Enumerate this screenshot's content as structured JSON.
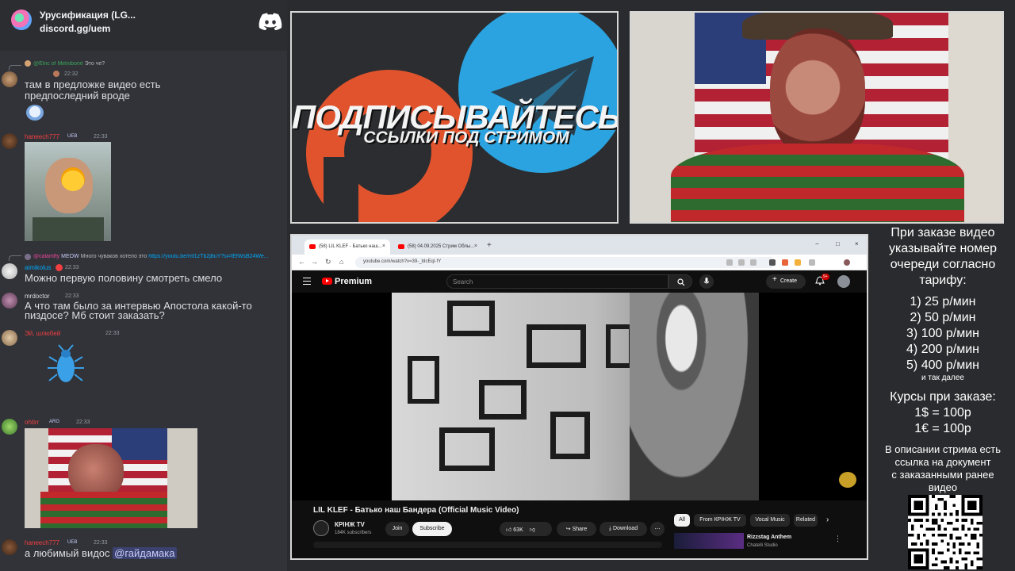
{
  "discord": {
    "server_name": "Урусификация (LG...",
    "server_invite": "discord.gg/uem",
    "messages": [
      {
        "reply_user": "@Elric of Melniboné",
        "reply_text": "Это че?",
        "username": "",
        "timestamp": "22:32",
        "text_lines": [
          "там в предложке видео есть",
          "предпоследний вроде"
        ]
      },
      {
        "username": "haneech777",
        "tag": "UEB",
        "timestamp": "22:33",
        "text_lines": []
      },
      {
        "reply_user": "@calamfty",
        "reply_tag": "MEOW",
        "reply_text": "Много чуваков хотело это",
        "reply_link": "https://youtu.be/mf1zTb2j8uY?si=fEfWsB24We...",
        "username": "aimikolus",
        "timestamp": "22:33",
        "text_lines": [
          "Можно первую половину смотреть смело"
        ]
      },
      {
        "username": "mrdoctor",
        "timestamp": "22:33",
        "text_lines": [
          "А что там было за интервью Апостола какой-то",
          "пиздосе? Мб стоит заказать?"
        ]
      },
      {
        "username": "Эй, шлюбей",
        "timestamp": "22:33",
        "text_lines": []
      },
      {
        "username": "ohtirr",
        "tag": "ARG",
        "timestamp": "22:33",
        "text_lines": []
      },
      {
        "username": "haneech777",
        "tag": "UEB",
        "timestamp": "22:33",
        "text_prefix": "а любимый видос",
        "mention": "@гайдамака"
      }
    ]
  },
  "promo": {
    "title": "ПОДПИСЫВАЙТЕСЬ",
    "subtitle": "ССЫЛКИ ПОД СТРИМОМ"
  },
  "browser": {
    "tabs": [
      {
        "label": "(58) LIL KLEF - Батько наш..."
      },
      {
        "label": "(58) 04.09.2025 Стрим Облы..."
      }
    ],
    "url": "youtube.com/watch?v=39-_bIcEqI-fY",
    "youtube": {
      "brand": "Premium",
      "search_placeholder": "Search",
      "create_label": "Create",
      "notifications_badge": "9+",
      "video_title": "LIL KLEF - Батько наш Бандера (Official Music Video)",
      "channel_name": "КРІНЖ TV",
      "channel_subs": "184K subscribers",
      "join_label": "Join",
      "subscribe_label": "Subscribe",
      "likes": "63K",
      "share_label": "Share",
      "download_label": "Download",
      "chips": [
        "All",
        "From КРІНЖ TV",
        "Vocal Music",
        "Related"
      ],
      "rec_title": "Rizzstag Anthem",
      "rec_channel": "Chatelli Studio"
    }
  },
  "info_panel": {
    "intro": [
      "При заказе видео",
      "указывайте номер",
      "очереди согласно",
      "тарифу:"
    ],
    "tariffs": [
      "1) 25 р/мин",
      "2) 50 р/мин",
      "3) 100 р/мин",
      "4) 200 р/мин",
      "5) 400 р/мин"
    ],
    "etc": "и так далее",
    "rates_title": "Курсы при заказе:",
    "rates": [
      "1$ = 100р",
      "1€ = 100р"
    ],
    "outro": [
      "В описании стрима есть",
      "ссылка на документ",
      "с заказанными ранее",
      "видео"
    ]
  },
  "colors": {
    "discord_bg": "#313338",
    "username_red": "#f23f42",
    "username_blue": "#00a8fc",
    "username_white": "#dbdee1",
    "youtube_red": "#ff0000",
    "telegram_blue": "#2aa3e0",
    "patreon_orange": "#e0532d"
  }
}
